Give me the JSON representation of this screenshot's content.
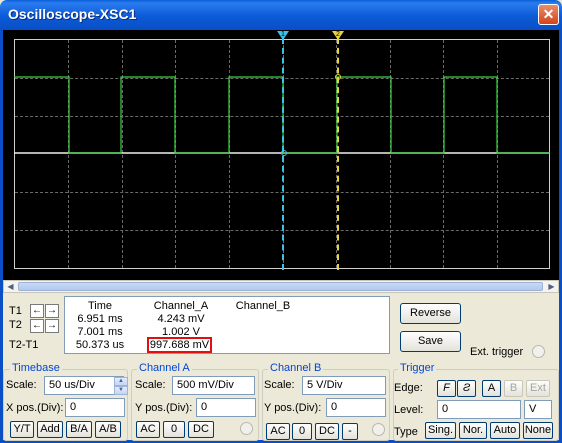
{
  "window": {
    "title": "Oscilloscope-XSC1",
    "close_glyph": "✕"
  },
  "scope": {
    "markers": {
      "t1": "1",
      "t2": "2"
    },
    "colors": {
      "background": "#000000",
      "channel_a": "#3ed43e",
      "channel_b": "#f0f0f0",
      "cursor_t1": "#3ec3e8",
      "cursor_t2": "#e8d23e"
    }
  },
  "readout": {
    "row_labels": [
      "T1",
      "T2",
      "T2-T1"
    ],
    "headers": {
      "time": "Time",
      "channel_a": "Channel_A",
      "channel_b": "Channel_B"
    },
    "t1": {
      "time": "6.951 ms",
      "channel_a": "4.243 mV",
      "channel_b": ""
    },
    "t2": {
      "time": "7.001 ms",
      "channel_a": "1.002 V",
      "channel_b": ""
    },
    "delta": {
      "time": "50.373 us",
      "channel_a": "997.688 mV",
      "channel_b": ""
    }
  },
  "actions": {
    "reverse": "Reverse",
    "save": "Save",
    "ext_trigger": "Ext. trigger"
  },
  "timebase": {
    "title": "Timebase",
    "scale_label": "Scale:",
    "scale_value": "50 us/Div",
    "xpos_label": "X pos.(Div):",
    "xpos_value": "0",
    "buttons": [
      "Y/T",
      "Add",
      "B/A",
      "A/B"
    ]
  },
  "channel_a": {
    "title": "Channel A",
    "scale_label": "Scale:",
    "scale_value": "500 mV/Div",
    "ypos_label": "Y pos.(Div):",
    "ypos_value": "0",
    "buttons": [
      "AC",
      "0",
      "DC"
    ]
  },
  "channel_b": {
    "title": "Channel B",
    "scale_label": "Scale:",
    "scale_value": "5  V/Div",
    "ypos_label": "Y pos.(Div):",
    "ypos_value": "0",
    "buttons": [
      "AC",
      "0",
      "DC",
      "-"
    ]
  },
  "trigger": {
    "title": "Trigger",
    "edge_label": "Edge:",
    "edge_buttons": [
      "F",
      "Ƨ"
    ],
    "source_buttons": [
      "A",
      "B",
      "Ext"
    ],
    "level_label": "Level:",
    "level_value": "0",
    "level_unit": "V",
    "type_label": "Type",
    "type_buttons": [
      "Sing.",
      "Nor.",
      "Auto",
      "None"
    ]
  }
}
